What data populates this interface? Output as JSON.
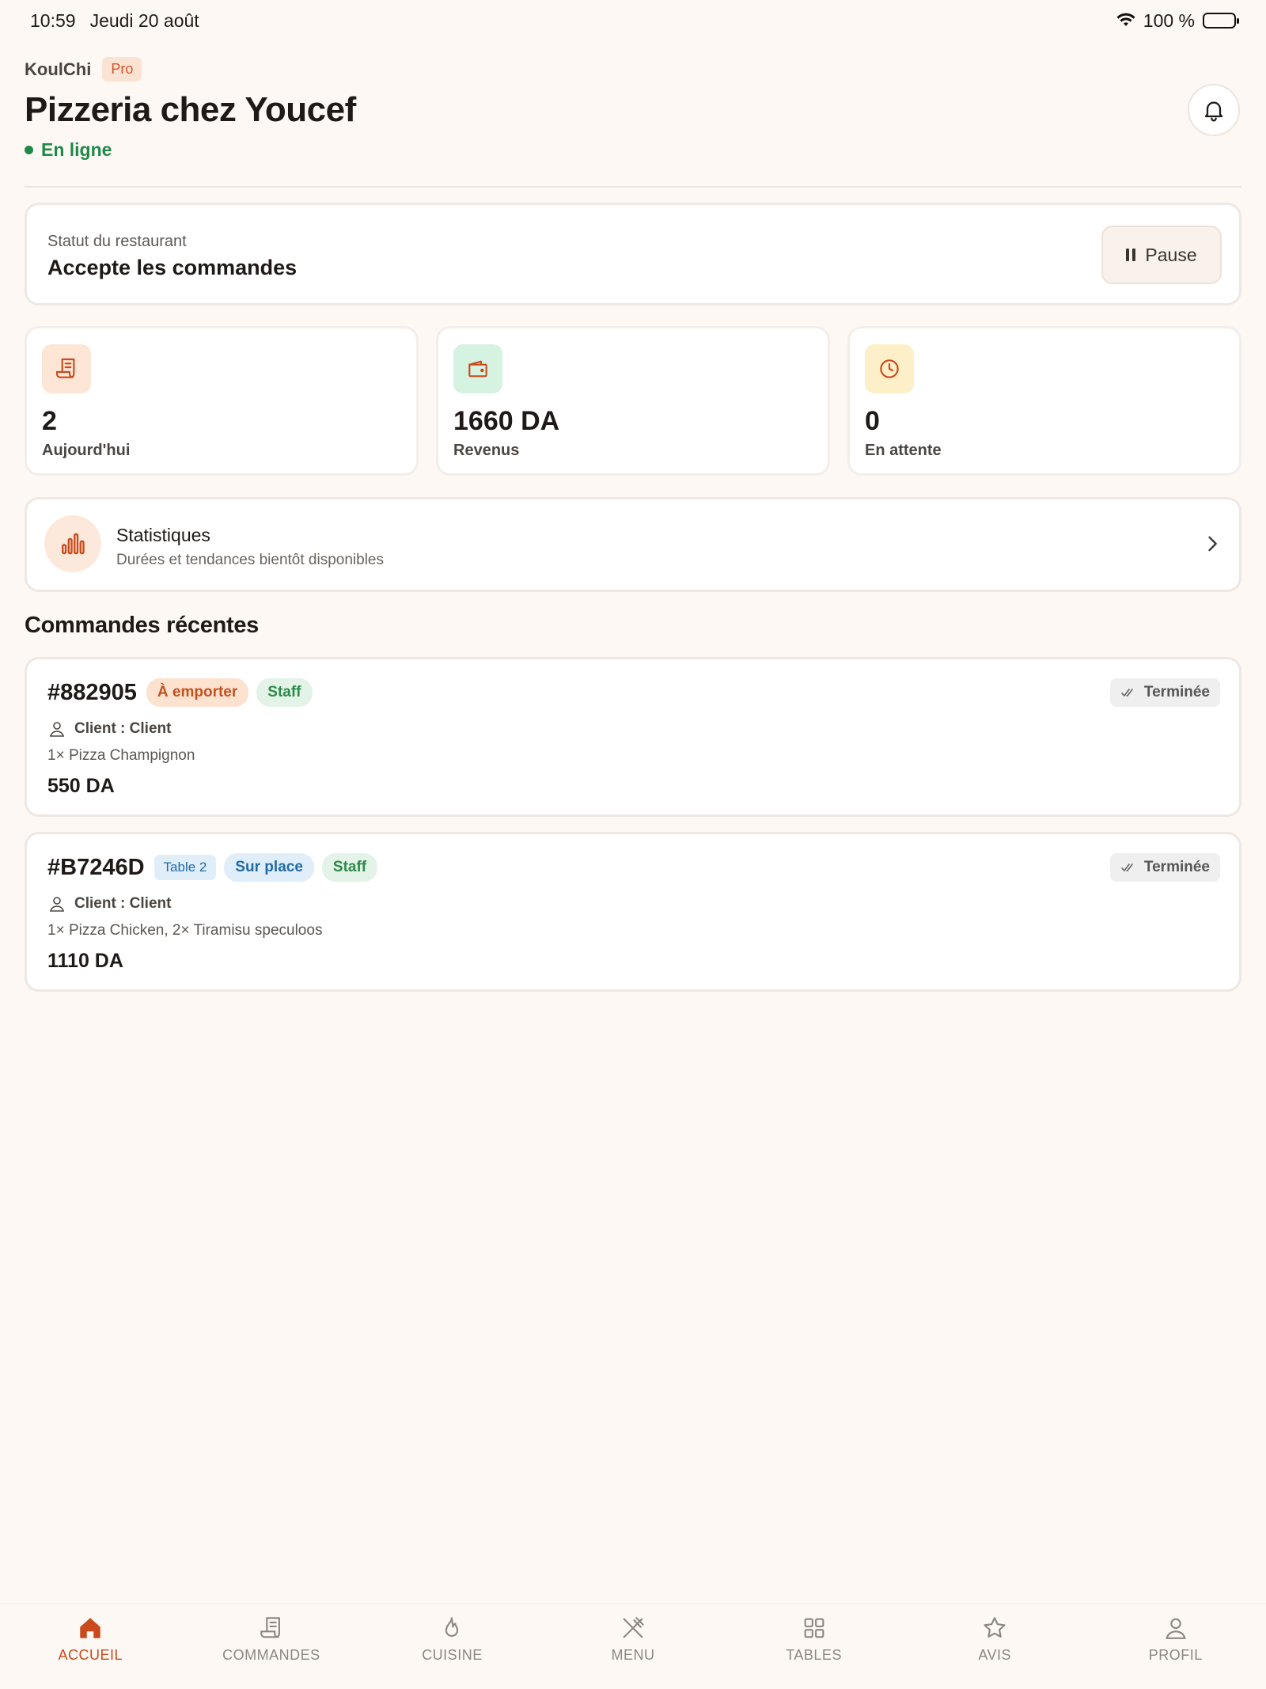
{
  "status_bar": {
    "time": "10:59",
    "date": "Jeudi 20 août",
    "battery": "100 %"
  },
  "header": {
    "brand": "KoulChi",
    "badge": "Pro",
    "restaurant_name": "Pizzeria chez Youcef",
    "online_status": "En ligne"
  },
  "restaurant_status": {
    "label": "Statut du restaurant",
    "value": "Accepte les commandes",
    "pause_label": "Pause"
  },
  "stats": [
    {
      "value": "2",
      "label": "Aujourd'hui",
      "icon": "receipt-icon",
      "color": "#c94a1c"
    },
    {
      "value": "1660 DA",
      "label": "Revenus",
      "icon": "wallet-icon",
      "color": "#c94a1c"
    },
    {
      "value": "0",
      "label": "En attente",
      "icon": "clock-icon",
      "color": "#c94a1c"
    }
  ],
  "statistics_link": {
    "title": "Statistiques",
    "subtitle": "Durées et tendances bientôt disponibles"
  },
  "recent_orders": {
    "title": "Commandes récentes",
    "orders": [
      {
        "id": "#882905",
        "type": "À emporter",
        "source": "Staff",
        "status": "Terminée",
        "client": "Client : Client",
        "items": "1× Pizza Champignon",
        "total": "550 DA"
      },
      {
        "id": "#B7246D",
        "table": "Table 2",
        "type": "Sur place",
        "source": "Staff",
        "status": "Terminée",
        "client": "Client : Client",
        "items": "1× Pizza Chicken, 2× Tiramisu speculoos",
        "total": "1110 DA"
      }
    ]
  },
  "bottom_nav": [
    {
      "label": "ACCUEIL",
      "icon": "home-icon",
      "active": true
    },
    {
      "label": "COMMANDES",
      "icon": "receipt-icon",
      "active": false
    },
    {
      "label": "CUISINE",
      "icon": "flame-icon",
      "active": false
    },
    {
      "label": "MENU",
      "icon": "utensils-icon",
      "active": false
    },
    {
      "label": "TABLES",
      "icon": "grid-icon",
      "active": false
    },
    {
      "label": "AVIS",
      "icon": "star-icon",
      "active": false
    },
    {
      "label": "PROFIL",
      "icon": "user-icon",
      "active": false
    }
  ],
  "colors": {
    "accent": "#c94a1c",
    "online": "#1f8a47",
    "background": "#fdf8f4"
  }
}
